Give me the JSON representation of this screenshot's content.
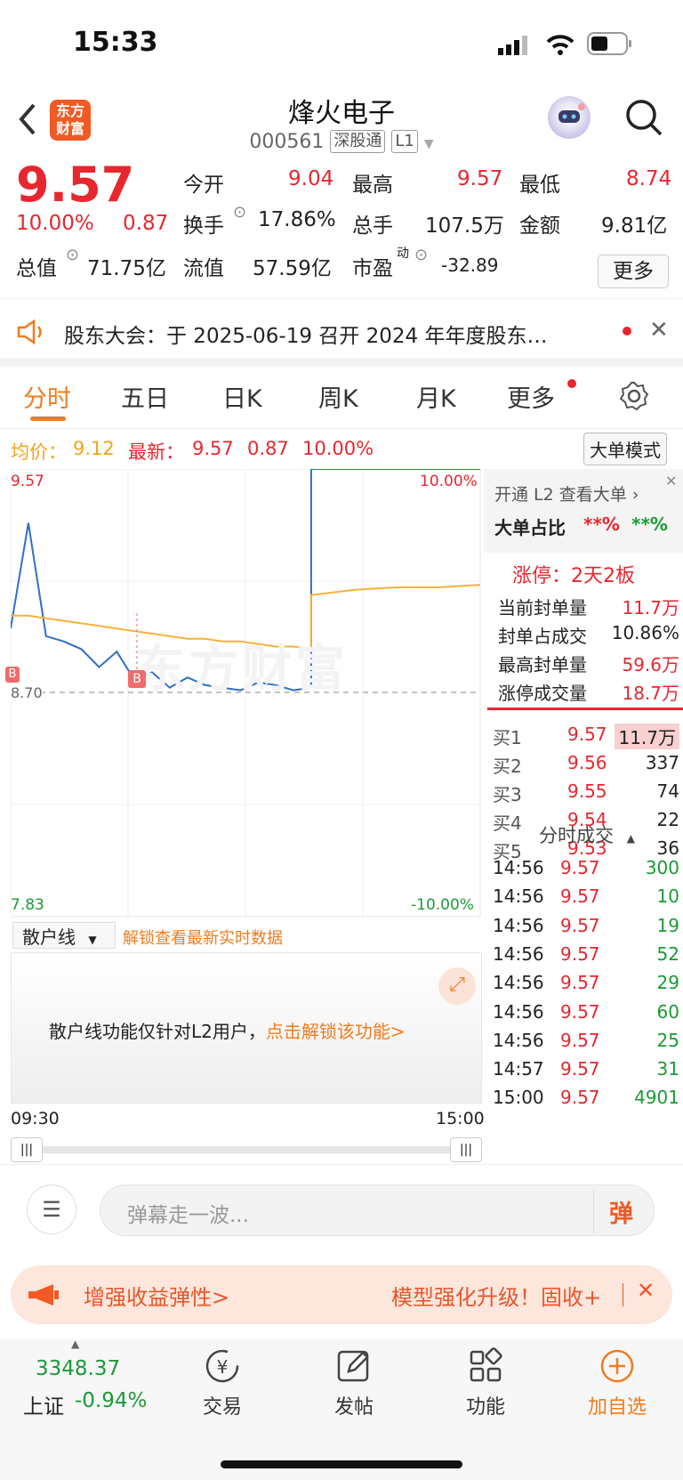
{
  "status": {
    "time": "15:33"
  },
  "header": {
    "logo_text": "东方\n财富",
    "title": "烽火电子",
    "code": "000561",
    "tag1": "深股通",
    "tag2": "L1"
  },
  "quote": {
    "price": "9.57",
    "pct": "10.00%",
    "change": "0.87",
    "open_label": "今开",
    "open": "9.04",
    "high_label": "最高",
    "high": "9.57",
    "low_label": "最低",
    "low": "8.74",
    "turnover_label": "换手",
    "turnover": "17.86%",
    "volume_label": "总手",
    "volume": "107.5万",
    "amount_label": "金额",
    "amount": "9.81亿",
    "mktcap_label": "总值",
    "mktcap": "71.75亿",
    "float_label": "流值",
    "float": "57.59亿",
    "pe_label": "市盈",
    "pe_sup": "动",
    "pe": "-32.89",
    "more_label": "更多"
  },
  "notice": {
    "text": "股东大会：于 2025-06-19 召开 2024 年年度股东…"
  },
  "tabs": [
    "分时",
    "五日",
    "日K",
    "周K",
    "月K",
    "更多"
  ],
  "avg": {
    "avg_label": "均价：",
    "avg": "9.12",
    "latest_label": "最新：",
    "latest": "9.57",
    "chg": "0.87",
    "pct": "10.00%",
    "mode_btn": "大单模式"
  },
  "chart": {
    "y_top": "9.57",
    "y_bottom": "7.83",
    "pct_top": "10.00%",
    "pct_bottom": "-10.00%",
    "ref_label": "8.70",
    "marker": "B",
    "watermark": "东方财富",
    "x_start": "09:30",
    "x_end": "15:00",
    "sub_selector": "散户线",
    "sub_unlock": "解锁查看最新实时数据",
    "sub_msg": "散户线功能仅针对L2用户，",
    "sub_link": "点击解锁该功能>"
  },
  "chart_data": {
    "type": "line",
    "x": [
      "09:30",
      "15:00"
    ],
    "ylim": [
      7.83,
      9.57
    ],
    "series": [
      {
        "name": "最新",
        "values": [
          8.95,
          9.36,
          8.92,
          8.9,
          8.87,
          8.8,
          8.86,
          8.75,
          8.78,
          8.72,
          8.76,
          8.73,
          8.72,
          8.71,
          8.74,
          8.73,
          8.71,
          8.72,
          9.57,
          9.57,
          9.57,
          9.57,
          9.57
        ]
      },
      {
        "name": "均价",
        "values": [
          9.0,
          9.0,
          8.99,
          8.98,
          8.97,
          8.96,
          8.95,
          8.94,
          8.93,
          8.92,
          8.91,
          8.91,
          8.9,
          8.9,
          8.89,
          8.88,
          8.88,
          8.87,
          9.08,
          9.1,
          9.11,
          9.11,
          9.12
        ]
      }
    ],
    "reference_line": 8.7,
    "colors": {
      "price": "#2f6fc4",
      "avg": "#f3b33c"
    }
  },
  "l2panel": {
    "open_l2": "开通 L2 查看大单 ›",
    "big_ratio_label": "大单占比",
    "big_red": "**%",
    "big_green": "**%",
    "limit_title": "涨停：2天2板",
    "rows": [
      {
        "label": "当前封单量",
        "value": "11.7万"
      },
      {
        "label": "封单占成交",
        "value": "10.86%"
      },
      {
        "label": "最高封单量",
        "value": "59.6万"
      },
      {
        "label": "涨停成交量",
        "value": "18.7万"
      }
    ]
  },
  "orderbook": [
    {
      "label": "买1",
      "price": "9.57",
      "vol": "11.7万"
    },
    {
      "label": "买2",
      "price": "9.56",
      "vol": "337"
    },
    {
      "label": "买3",
      "price": "9.55",
      "vol": "74"
    },
    {
      "label": "买4",
      "price": "9.54",
      "vol": "22"
    },
    {
      "label": "买5",
      "price": "9.53",
      "vol": "36"
    }
  ],
  "trades_title": "分时成交",
  "trades": [
    {
      "time": "14:56",
      "price": "9.57",
      "vol": "300"
    },
    {
      "time": "14:56",
      "price": "9.57",
      "vol": "10"
    },
    {
      "time": "14:56",
      "price": "9.57",
      "vol": "19"
    },
    {
      "time": "14:56",
      "price": "9.57",
      "vol": "52"
    },
    {
      "time": "14:56",
      "price": "9.57",
      "vol": "29"
    },
    {
      "time": "14:56",
      "price": "9.57",
      "vol": "60"
    },
    {
      "time": "14:56",
      "price": "9.57",
      "vol": "25"
    },
    {
      "time": "14:57",
      "price": "9.57",
      "vol": "31"
    },
    {
      "time": "15:00",
      "price": "9.57",
      "vol": "4901"
    }
  ],
  "danmu": {
    "placeholder": "弹幕走一波...",
    "btn": "弹"
  },
  "promo": {
    "left": "增强收益弹性>",
    "right": "模型强化升级！固收+"
  },
  "bottom": {
    "index_value": "3348.37",
    "index_name": "上证",
    "index_pct": "-0.94%",
    "items": [
      "交易",
      "发帖",
      "功能",
      "加自选"
    ]
  }
}
